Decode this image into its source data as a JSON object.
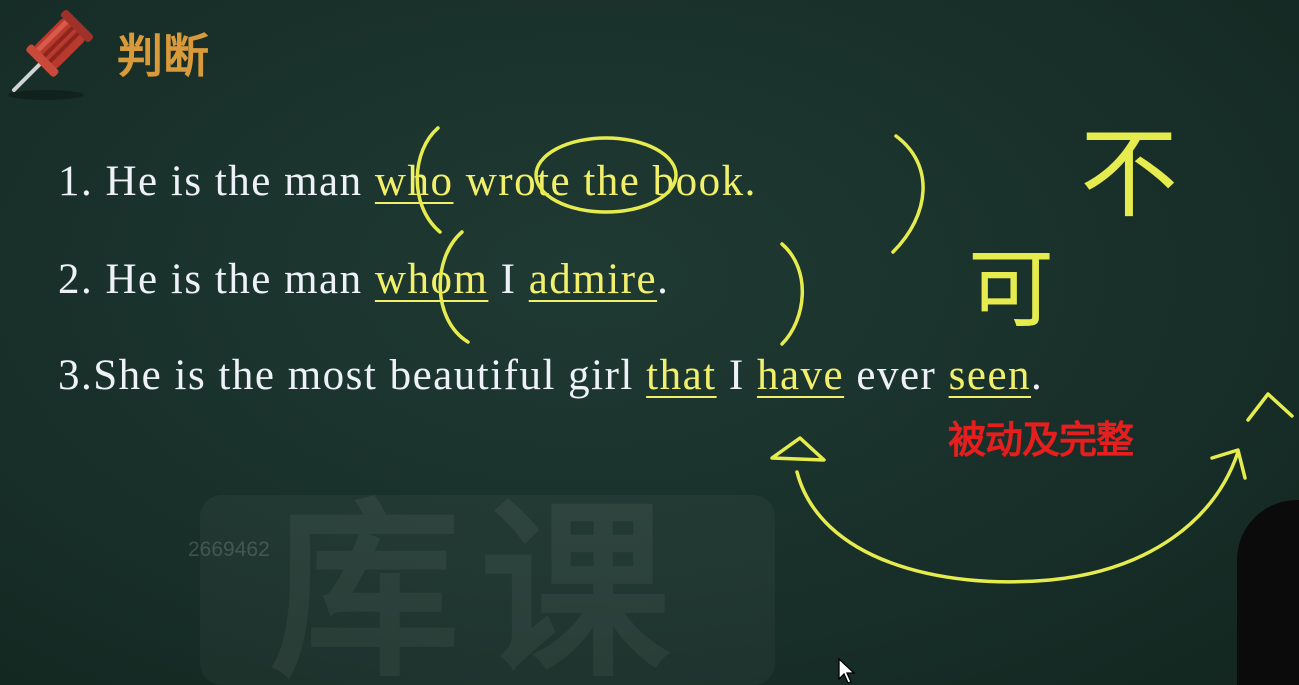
{
  "header": {
    "title": "判断",
    "pin_icon": "pushpin-icon"
  },
  "watermark": {
    "id_text": "2669462",
    "logo_text": "库课"
  },
  "sentences": [
    {
      "number": "1. ",
      "pre": "He is the man ",
      "w1": "who",
      "sp1": " ",
      "w2": "wrote",
      "post": " the book."
    },
    {
      "number": "2. ",
      "pre": "He is the man ",
      "w1": "whom",
      "mid": " I ",
      "w2": "admire",
      "post": "."
    },
    {
      "number": "3.",
      "pre": "She is the most beautiful girl ",
      "w1": "that",
      "mid": " I ",
      "w2": "have",
      "mid2": " ever ",
      "w3": "seen",
      "post": "."
    }
  ],
  "annotations": {
    "handwritten_1": "不",
    "handwritten_2": "可",
    "note": "被动及完整"
  },
  "colors": {
    "board": "#19302a",
    "chalk_white": "#eef1f7",
    "chalk_yellow": "#f2f06a",
    "title_orange": "#d99a3a",
    "note_red": "#e61e1e"
  }
}
